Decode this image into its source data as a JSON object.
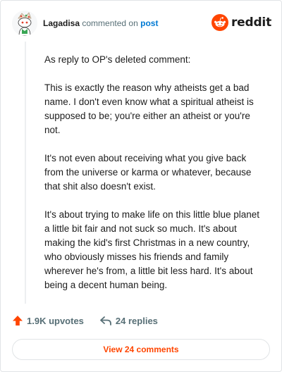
{
  "header": {
    "username": "Lagadisa",
    "action_text": "commented on",
    "target_text": "post",
    "logo_text": "reddit"
  },
  "comment": {
    "paragraphs": [
      "As reply to OP's deleted comment:",
      "This is exactly the reason why atheists get a bad name. I don't even know what a spiritual atheist is supposed to be; you're either an atheist or you're not.",
      "It's not even about receiving what you give back from the universe or karma or whatever, because that shit also doesn't exist.",
      "It's about trying to make life on this little blue planet a little bit fair and not suck so much. It's about making the kid's first Christmas in a new country, who obviously misses his friends and family wherever he's from, a little bit less hard. It's about being a decent human being."
    ]
  },
  "footer": {
    "upvotes": "1.9K upvotes",
    "replies": "24 replies",
    "view_button": "View 24 comments"
  },
  "colors": {
    "reddit_orange": "#ff4500",
    "link_blue": "#0079d3",
    "muted_text": "#576f76"
  },
  "icons": {
    "avatar": "avatar-snoo-icon",
    "logo": "reddit-snoo-icon",
    "upvote": "upvote-arrow-icon",
    "reply": "reply-arrow-icon"
  }
}
